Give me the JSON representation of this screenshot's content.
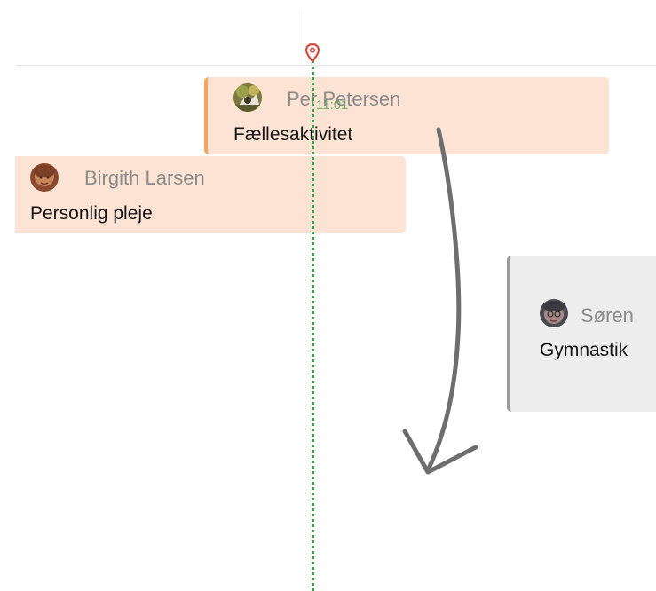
{
  "timeline": {
    "current_time": "11:01"
  },
  "events": [
    {
      "person": "Per Petersen",
      "activity": "Fællesaktivitet",
      "avatar_icon": "person-photo-icon",
      "accent": "#f4a45f",
      "background": "#fde3d3"
    },
    {
      "person": "Birgith Larsen",
      "activity": "Personlig pleje",
      "avatar_icon": "person-photo-icon",
      "background": "#fde3d3"
    },
    {
      "person": "Søren",
      "activity": "Gymnastik",
      "avatar_icon": "person-photo-icon",
      "accent": "#9a9a9a",
      "background": "#ededed"
    }
  ],
  "colors": {
    "now_line": "#3a9a4a",
    "now_marker": "#e0463c",
    "drag_arrow": "#6e6e6e"
  }
}
